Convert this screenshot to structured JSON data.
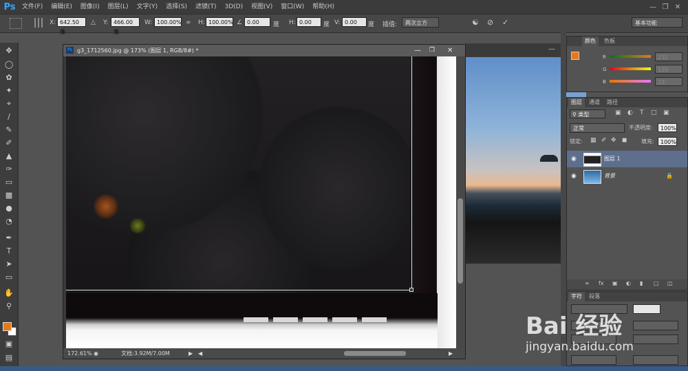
{
  "app": {
    "logo": "Ps"
  },
  "menu": [
    "文件(F)",
    "编辑(E)",
    "图像(I)",
    "图层(L)",
    "文字(Y)",
    "选择(S)",
    "滤镜(T)",
    "3D(D)",
    "视图(V)",
    "窗口(W)",
    "帮助(H)"
  ],
  "options": {
    "x_label": "X:",
    "x_value": "642.50 像",
    "y_label": "Y:",
    "y_value": "466.00 像",
    "w_label": "W:",
    "w_value": "100.00%",
    "h_label": "H:",
    "h_value": "100.00%",
    "angle_value": "0.00",
    "angle_unit": "度",
    "hskew_label": "H:",
    "hskew_value": "0.00",
    "hskew_unit": "度",
    "vskew_label": "V:",
    "vskew_value": "0.00",
    "vskew_unit": "度",
    "interp_label": "插值:",
    "interp_value": "两次立方",
    "workspace": "基本功能"
  },
  "document": {
    "title": "g3_1712560.jpg @ 173% (图层 1, RGB/8#) *",
    "zoom": "172.61%",
    "doc_info": "文档:3.92M/7.00M"
  },
  "color_panel": {
    "tabs": [
      "颜色",
      "色板"
    ],
    "channels": [
      {
        "label": "R",
        "value": "231"
      },
      {
        "label": "G",
        "value": "120"
      },
      {
        "label": "B",
        "value": "23"
      }
    ]
  },
  "layers_panel": {
    "tabs": [
      "图层",
      "通道",
      "路径"
    ],
    "kind": "类型",
    "blend": "正常",
    "opacity_label": "不透明度:",
    "opacity": "100%",
    "lock_label": "锁定:",
    "fill_label": "填充:",
    "fill": "100%",
    "layers": [
      {
        "name": "图层 1",
        "selected": true
      },
      {
        "name": "背景",
        "selected": false
      }
    ]
  },
  "char_panel": {
    "tabs": [
      "字符",
      "段落"
    ]
  },
  "watermark": {
    "text": "Bai 经验",
    "url": "jingyan.baidu.com"
  },
  "colors": {
    "foreground": "#e7781b",
    "background": "#ffffff",
    "accent": "#31a8ff",
    "selected_layer": "#5d6f8c"
  }
}
